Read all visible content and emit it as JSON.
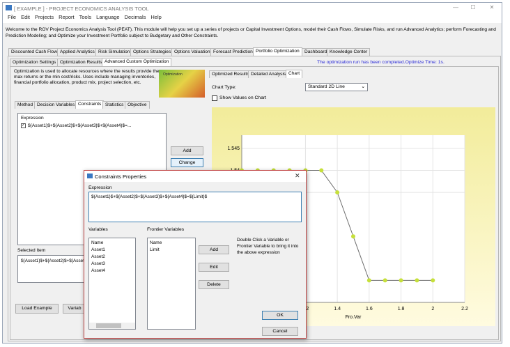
{
  "window": {
    "title": "[ EXAMPLE ] - PROJECT ECONOMICS ANALYSIS TOOL",
    "min": "—",
    "max": "☐",
    "close": "✕"
  },
  "menu": [
    "File",
    "Edit",
    "Projects",
    "Report",
    "Tools",
    "Language",
    "Decimals",
    "Help"
  ],
  "intro": "Welcome to the ROV Project Economics Analysis Tool (PEAT). This module will help you set up a series of projects or Capital Investment Options, model their Cash Flows, Simulate Risks, and run Advanced Analytics; perform Forecasting and Prediction Modeling; and Optimize your Investment Portfolio subject to Budgetary and Other Constraints.",
  "main_tabs": [
    "Discounted Cash Flow",
    "Applied Analytics",
    "Risk Simulation",
    "Options Strategies",
    "Options Valuation",
    "Forecast Prediction",
    "Portfolio Optimization",
    "Dashboard",
    "Knowledge Center"
  ],
  "sub_tabs": [
    "Optimization Settings",
    "Optimization Results",
    "Advanced Custom Optimization"
  ],
  "status": "The optimization run has been completed.Optimize Time: 1s.",
  "description": "Optimization is used to allocate resources where the results provide the max returns or the min cost/risks. Uses include managing inventories, financial portfolio allocation, product mix, project selection, etc.",
  "logo_text": "Optimization",
  "left_tabs": [
    "Method",
    "Decision Variables",
    "Constraints",
    "Statistics",
    "Objective"
  ],
  "expression_header": "Expression",
  "expression_item": "${Asset1}$+${Asset2}$+${Asset3}$+${Asset4}$=...",
  "add_label": "Add",
  "change_label": "Change",
  "selected_item_label": "Selected Item",
  "selected_item_value": "${Asset1}$+${Asset2}$+${Asset",
  "load_example": "Load Example",
  "variab_partial": "Variab",
  "right_tabs": [
    "Optimized Results",
    "Detailed Analysis",
    "Chart"
  ],
  "chart_type_label": "Chart Type:",
  "chart_type_value": "Standard 2D Line",
  "show_values_label": "Show Values on Chart",
  "chart_data": {
    "type": "line",
    "x": [
      0.8,
      0.9,
      1.0,
      1.1,
      1.2,
      1.3,
      1.4,
      1.5,
      1.6,
      1.7,
      1.8,
      1.9,
      2.0
    ],
    "y": [
      1.54,
      1.54,
      1.54,
      1.54,
      1.54,
      1.54,
      1.535,
      1.525,
      1.515,
      1.515,
      1.515,
      1.515,
      1.515
    ],
    "xticks": [
      "1.2",
      "1.4",
      "1.6",
      "1.8",
      "2",
      "2.2"
    ],
    "yticks": [
      "1.545",
      "1.54",
      "1.535"
    ],
    "xlabel": "Fro.Var",
    "line_color": "#6d6d6d",
    "marker_color": "#c6e03b"
  },
  "dialog": {
    "title": "Constraints Properties",
    "expression_label": "Expression",
    "expression_value": "${Asset1}$+${Asset2}$+${Asset3}$+${Asset4}$=${Limit}$",
    "variables_label": "Variables",
    "variables": [
      "Name",
      "Asset1",
      "Asset2",
      "Asset3",
      "Asset4"
    ],
    "frontier_label": "Frontier Variables",
    "frontier": [
      "Name",
      "Limit"
    ],
    "add": "Add",
    "edit": "Edit",
    "delete": "Delete",
    "hint": "Double Click a Variable or Frontier Variable to bring it into the above expression",
    "ok": "OK",
    "cancel": "Cancel",
    "close": "✕"
  }
}
